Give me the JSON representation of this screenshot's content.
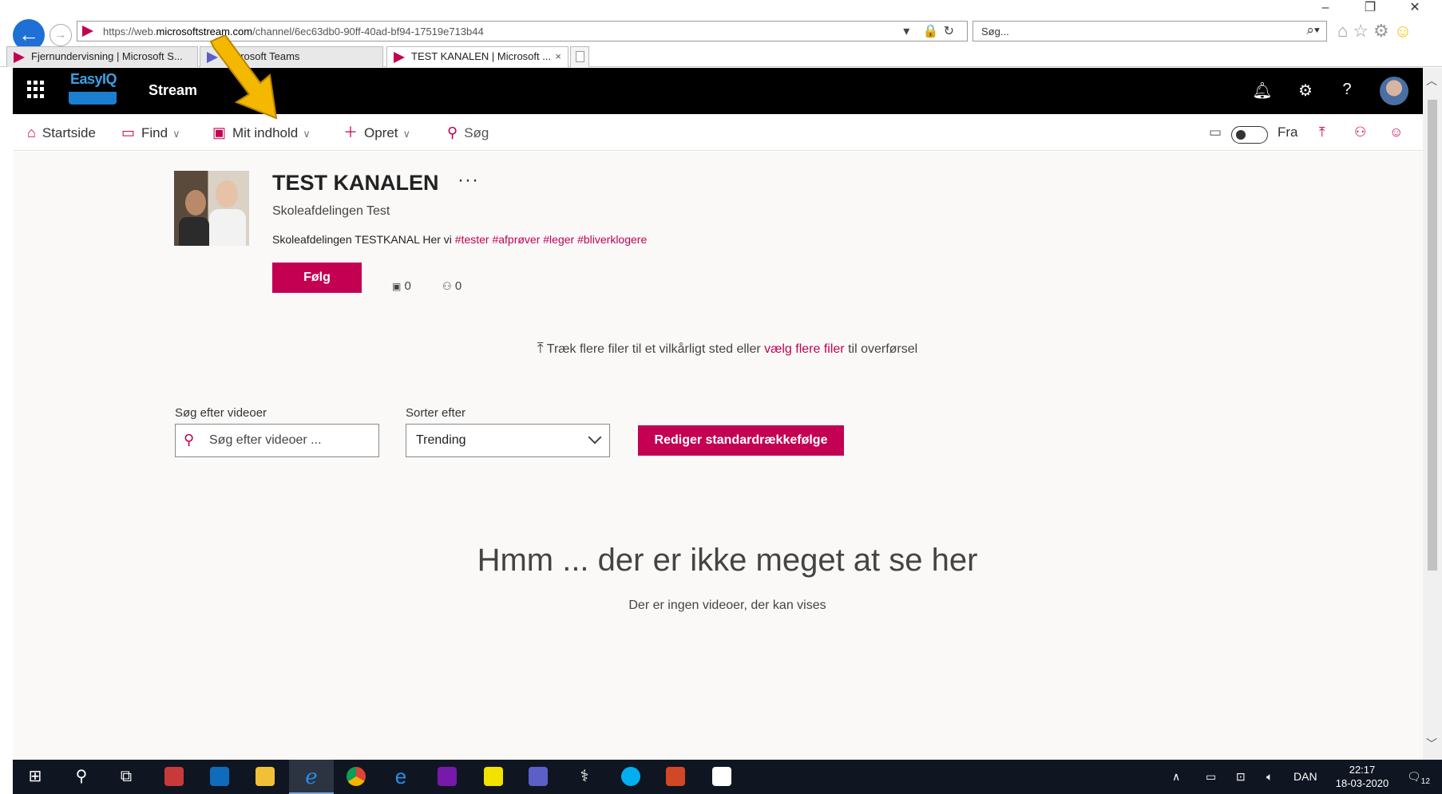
{
  "browser": {
    "url_prefix": "https://web.",
    "url_domain": "microsoftstream.com",
    "url_path": "/channel/6ec63db0-90ff-40ad-bf94-17519e713b44",
    "search_placeholder": "Søg...",
    "tabs": [
      {
        "label": "Fjernundervisning | Microsoft S..."
      },
      {
        "label": "Microsoft Teams"
      },
      {
        "label": "TEST KANALEN | Microsoft ...",
        "close": "×"
      }
    ],
    "window_controls": {
      "minimize": "–",
      "restore": "❐",
      "close": "✕"
    }
  },
  "appbar": {
    "logo_text": "EasyIQ",
    "app_name": "Stream"
  },
  "nav": {
    "home": "Startside",
    "find": "Find",
    "my_content": "Mit indhold",
    "create": "Opret",
    "search": "Søg",
    "toggle_label": "Fra"
  },
  "channel": {
    "title": "TEST KANALEN",
    "more": "···",
    "subtitle": "Skoleafdelingen Test",
    "description_text": "Skoleafdelingen TESTKANAL Her vi ",
    "hashtags": "#tester #afprøver #leger #bliverklogere",
    "follow_label": "Følg",
    "video_count": "0",
    "follower_count": "0"
  },
  "upload": {
    "prefix": "Træk flere filer til et vilkårligt sted eller ",
    "link": "vælg flere filer",
    "suffix": " til overførsel"
  },
  "filters": {
    "search_label": "Søg efter videoer",
    "search_placeholder": "Søg efter videoer ...",
    "sort_label": "Sorter efter",
    "sort_value": "Trending",
    "edit_button": "Rediger standardrækkefølge"
  },
  "empty_state": {
    "title": "Hmm ... der er ikke meget at se her",
    "subtitle": "Der er ingen videoer, der kan vises"
  },
  "taskbar": {
    "language": "DAN",
    "time": "22:17",
    "date": "18-03-2020",
    "notifications": "12"
  },
  "colors": {
    "accent": "#c30052",
    "appbar": "#000000",
    "content_bg": "#faf9f8",
    "annotation_arrow": "#f5b800"
  }
}
